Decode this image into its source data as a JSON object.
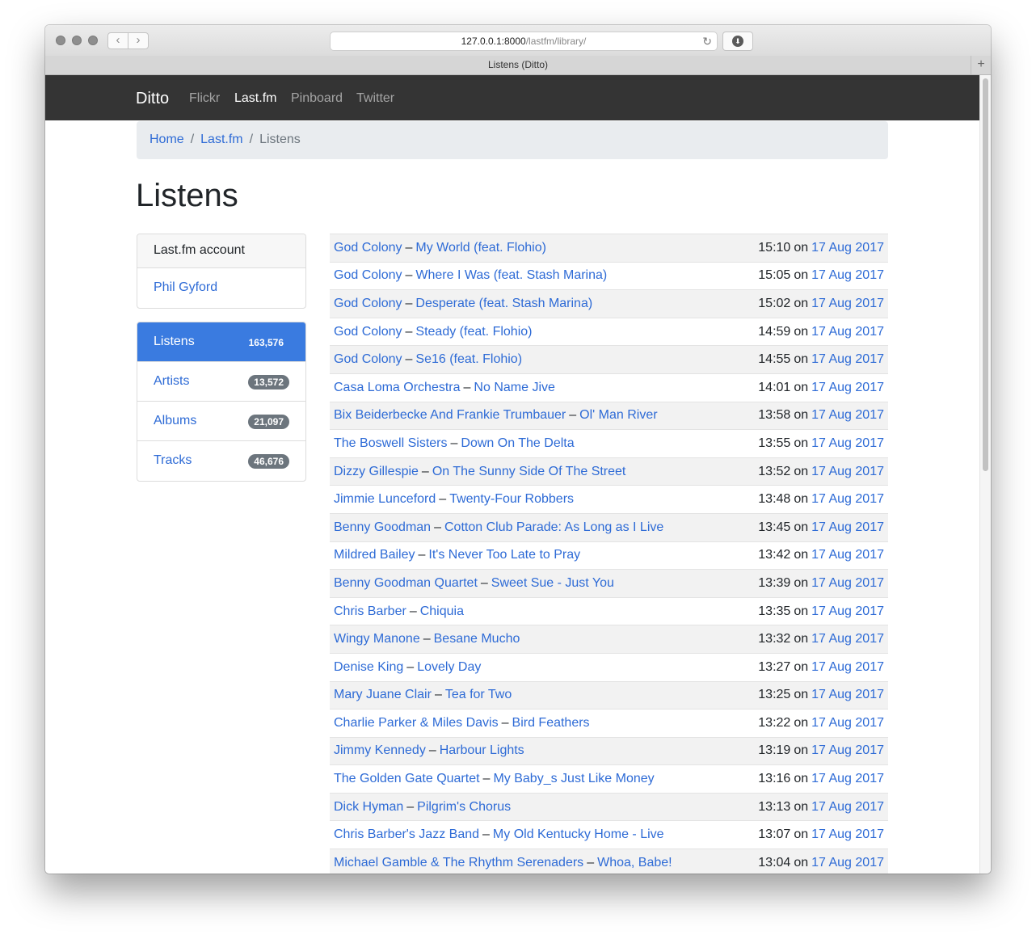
{
  "browser": {
    "url_host": "127.0.0.1:8000",
    "url_path": "/lastfm/library/",
    "tab_title": "Listens (Ditto)"
  },
  "navbar": {
    "brand": "Ditto",
    "links": [
      "Flickr",
      "Last.fm",
      "Pinboard",
      "Twitter"
    ],
    "active": "Last.fm"
  },
  "breadcrumb": {
    "home": "Home",
    "section": "Last.fm",
    "current": "Listens",
    "separator": "/"
  },
  "page": {
    "title": "Listens"
  },
  "account_card": {
    "header": "Last.fm account",
    "name": "Phil Gyford"
  },
  "sidebar": {
    "items": [
      {
        "label": "Listens",
        "count": "163,576",
        "active": true
      },
      {
        "label": "Artists",
        "count": "13,572"
      },
      {
        "label": "Albums",
        "count": "21,097"
      },
      {
        "label": "Tracks",
        "count": "46,676"
      }
    ]
  },
  "listens": [
    {
      "artist": "God Colony",
      "track": "My World (feat. Flohio)",
      "time": "15:10",
      "date": "17 Aug 2017"
    },
    {
      "artist": "God Colony",
      "track": "Where I Was (feat. Stash Marina)",
      "time": "15:05",
      "date": "17 Aug 2017"
    },
    {
      "artist": "God Colony",
      "track": "Desperate (feat. Stash Marina)",
      "time": "15:02",
      "date": "17 Aug 2017"
    },
    {
      "artist": "God Colony",
      "track": "Steady (feat. Flohio)",
      "time": "14:59",
      "date": "17 Aug 2017"
    },
    {
      "artist": "God Colony",
      "track": "Se16 (feat. Flohio)",
      "time": "14:55",
      "date": "17 Aug 2017"
    },
    {
      "artist": "Casa Loma Orchestra",
      "track": "No Name Jive",
      "time": "14:01",
      "date": "17 Aug 2017"
    },
    {
      "artist": "Bix Beiderbecke And Frankie Trumbauer",
      "track": "Ol' Man River",
      "time": "13:58",
      "date": "17 Aug 2017"
    },
    {
      "artist": "The Boswell Sisters",
      "track": "Down On The Delta",
      "time": "13:55",
      "date": "17 Aug 2017"
    },
    {
      "artist": "Dizzy Gillespie",
      "track": "On The Sunny Side Of The Street",
      "time": "13:52",
      "date": "17 Aug 2017"
    },
    {
      "artist": "Jimmie Lunceford",
      "track": "Twenty-Four Robbers",
      "time": "13:48",
      "date": "17 Aug 2017"
    },
    {
      "artist": "Benny Goodman",
      "track": "Cotton Club Parade: As Long as I Live",
      "time": "13:45",
      "date": "17 Aug 2017"
    },
    {
      "artist": "Mildred Bailey",
      "track": "It's Never Too Late to Pray",
      "time": "13:42",
      "date": "17 Aug 2017"
    },
    {
      "artist": "Benny Goodman Quartet",
      "track": "Sweet Sue - Just You",
      "time": "13:39",
      "date": "17 Aug 2017"
    },
    {
      "artist": "Chris Barber",
      "track": "Chiquia",
      "time": "13:35",
      "date": "17 Aug 2017"
    },
    {
      "artist": "Wingy Manone",
      "track": "Besane Mucho",
      "time": "13:32",
      "date": "17 Aug 2017"
    },
    {
      "artist": "Denise King",
      "track": "Lovely Day",
      "time": "13:27",
      "date": "17 Aug 2017"
    },
    {
      "artist": "Mary Juane Clair",
      "track": "Tea for Two",
      "time": "13:25",
      "date": "17 Aug 2017"
    },
    {
      "artist": "Charlie Parker & Miles Davis",
      "track": "Bird Feathers",
      "time": "13:22",
      "date": "17 Aug 2017"
    },
    {
      "artist": "Jimmy Kennedy",
      "track": "Harbour Lights",
      "time": "13:19",
      "date": "17 Aug 2017"
    },
    {
      "artist": "The Golden Gate Quartet",
      "track": "My Baby_s Just Like Money",
      "time": "13:16",
      "date": "17 Aug 2017"
    },
    {
      "artist": "Dick Hyman",
      "track": "Pilgrim's Chorus",
      "time": "13:13",
      "date": "17 Aug 2017"
    },
    {
      "artist": "Chris Barber's Jazz Band",
      "track": "My Old Kentucky Home - Live",
      "time": "13:07",
      "date": "17 Aug 2017"
    },
    {
      "artist": "Michael Gamble & The Rhythm Serenaders",
      "track": "Whoa, Babe!",
      "time": "13:04",
      "date": "17 Aug 2017"
    }
  ],
  "labels": {
    "dash": "–",
    "on": "on"
  }
}
